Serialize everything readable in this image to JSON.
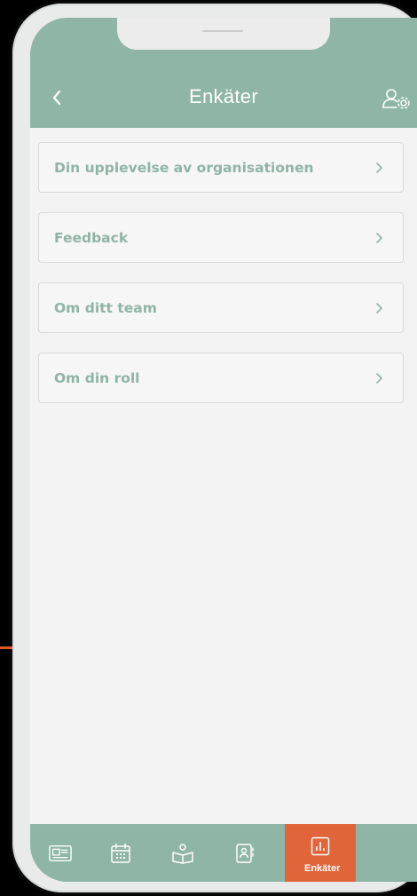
{
  "header": {
    "title": "Enkäter",
    "back_icon": "chevron-left-icon",
    "settings_icon": "user-settings-icon"
  },
  "surveys": [
    {
      "label": "Din upplevelse av organisationen"
    },
    {
      "label": "Feedback"
    },
    {
      "label": "Om ditt team"
    },
    {
      "label": "Om din roll"
    }
  ],
  "tabs": [
    {
      "icon": "newspaper-icon",
      "label": ""
    },
    {
      "icon": "calendar-icon",
      "label": ""
    },
    {
      "icon": "book-reader-icon",
      "label": ""
    },
    {
      "icon": "contacts-icon",
      "label": ""
    },
    {
      "icon": "bar-chart-icon",
      "label": "Enkäter",
      "active": true
    }
  ],
  "colors": {
    "primary": "#8eb5a6",
    "accent": "#e0653b",
    "background": "#f3f3f3",
    "item_text": "#8fb4a5"
  }
}
